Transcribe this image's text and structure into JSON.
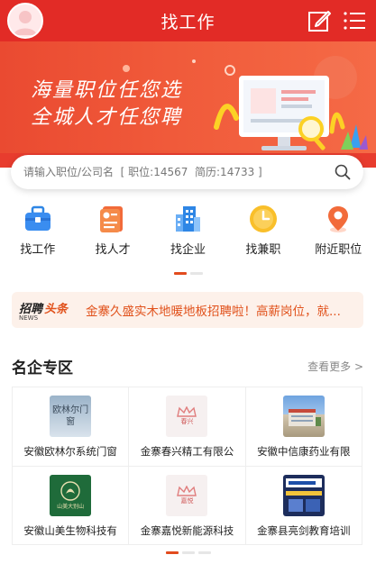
{
  "header": {
    "title": "找工作",
    "avatar_icon": "user-avatar-icon",
    "edit_icon": "edit-icon",
    "menu_icon": "menu-icon"
  },
  "banner": {
    "line1": "海量职位任您选",
    "line2": "全城人才任您聘"
  },
  "search": {
    "placeholder": "请输入职位/公司名  [ 职位:14567  简历:14733 ]"
  },
  "nav": {
    "items": [
      {
        "label": "找工作",
        "icon": "briefcase-icon"
      },
      {
        "label": "找人才",
        "icon": "resume-icon"
      },
      {
        "label": "找企业",
        "icon": "building-icon"
      },
      {
        "label": "找兼职",
        "icon": "clock-icon"
      },
      {
        "label": "附近职位",
        "icon": "location-pin-icon"
      }
    ]
  },
  "news": {
    "logo_main": "招聘",
    "logo_sub": "头条",
    "logo_en": "NEWS",
    "text": "金寨久盛实木地暖地板招聘啦！高薪岗位，就..."
  },
  "featured": {
    "title": "名企专区",
    "more": "查看更多 >",
    "companies": [
      {
        "name": "安徽欧林尔系统门窗",
        "logo_text": "欧林尔门窗"
      },
      {
        "name": "金寨春兴精工有限公",
        "logo_text": "春兴"
      },
      {
        "name": "安徽中信康药业有限",
        "logo_text": ""
      },
      {
        "name": "安徽山美生物科技有",
        "logo_text": "山美大别山"
      },
      {
        "name": "金寨嘉悦新能源科技",
        "logo_text": "嘉悦"
      },
      {
        "name": "金寨县亮剑教育培训",
        "logo_text": "亮剑"
      }
    ]
  },
  "colors": {
    "brand_red": "#e22b26",
    "news_orange": "#e1521c",
    "dot_active": "#e24b1e"
  }
}
